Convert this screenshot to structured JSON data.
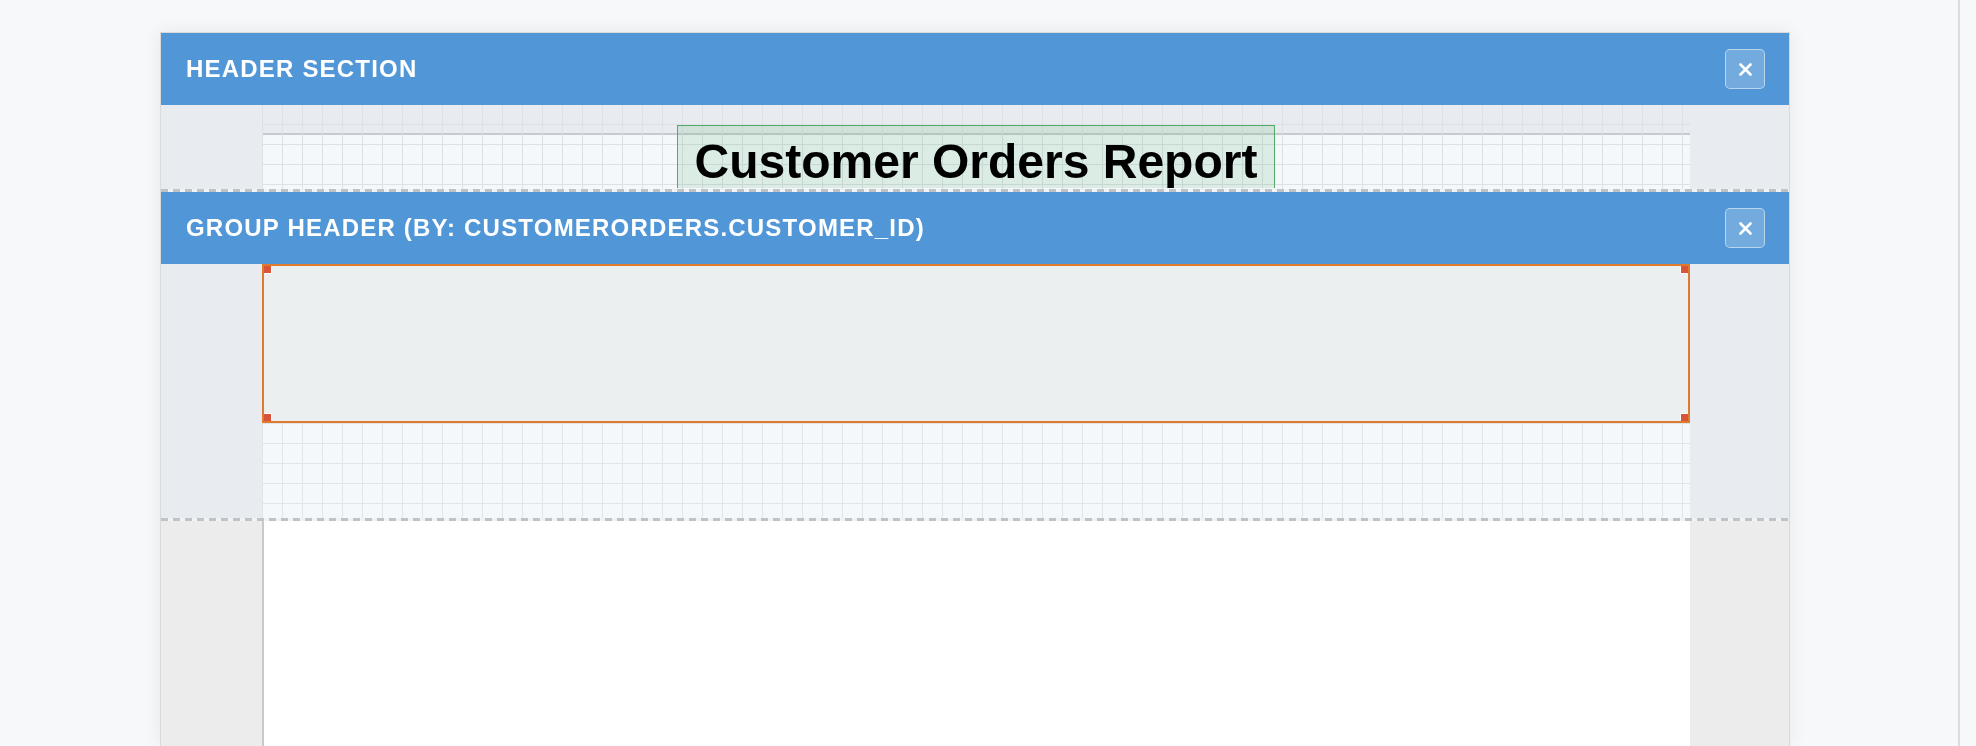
{
  "sections": [
    {
      "kind": "header",
      "title": "HEADER SECTION",
      "elements": [
        {
          "kind": "label",
          "text": "Customer Orders Report",
          "selected": false
        }
      ]
    },
    {
      "kind": "group_header",
      "title": "GROUP HEADER (BY: CUSTOMERORDERS.CUSTOMER_ID)",
      "elements": [
        {
          "kind": "panel",
          "selected": true
        }
      ]
    }
  ]
}
